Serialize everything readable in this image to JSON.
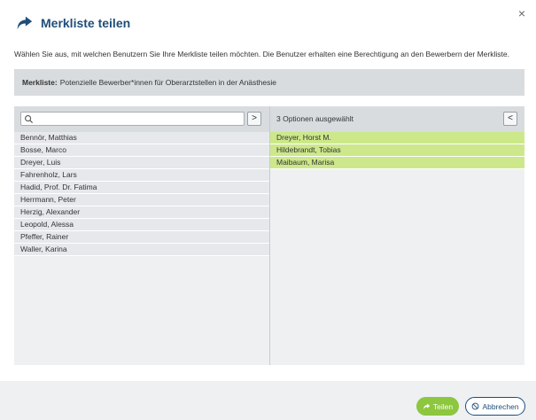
{
  "dialog": {
    "title": "Merkliste teilen",
    "close_label": "×",
    "intro": "Wählen Sie aus, mit welchen Benutzern Sie Ihre Merkliste teilen möchten. Die Benutzer erhalten eine Berechtigung an den Bewerbern der Merkliste."
  },
  "info": {
    "label": "Merkliste:",
    "value": "Potenzielle Bewerber*innen für Oberarztstellen in der Anästhesie"
  },
  "available": {
    "search_value": "",
    "move_right_label": ">",
    "items": [
      "Bennör, Matthias",
      "Bosse, Marco",
      "Dreyer, Luis",
      "Fahrenholz, Lars",
      "Hadid, Prof. Dr. Fatima",
      "Herrmann, Peter",
      "Herzig, Alexander",
      "Leopold, Alessa",
      "Pfeffer, Rainer",
      "Waller, Karina"
    ]
  },
  "selected": {
    "count_label": "3 Optionen ausgewählt",
    "move_left_label": "<",
    "items": [
      "Dreyer, Horst M.",
      "Hildebrandt, Tobias",
      "Maibaum, Marisa"
    ]
  },
  "footer": {
    "share_label": "Teilen",
    "cancel_label": "Abbrechen"
  },
  "colors": {
    "brand": "#1f4e79",
    "accent": "#8dc63f",
    "selected_row": "#cce88a"
  },
  "icons": {
    "title": "share-arrow-icon",
    "search": "search-icon",
    "close": "close-icon",
    "cancel": "ban-icon"
  }
}
